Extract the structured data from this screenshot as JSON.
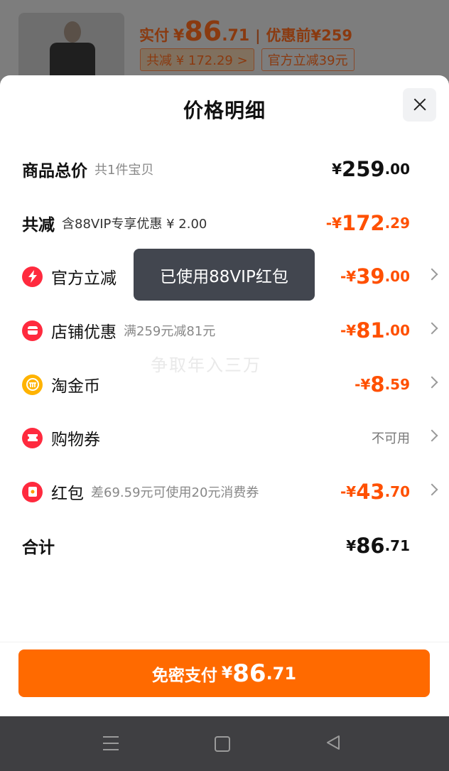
{
  "background": {
    "paid_label": "实付",
    "paid_symbol": "¥",
    "paid_int": "86",
    "paid_dec": ".71",
    "separator": "|",
    "before_label": "优惠前",
    "before_value": "¥259",
    "tag_discount": "共减 ¥ 172.29 >",
    "tag_official": "官方立减39元"
  },
  "sheet": {
    "title": "价格明细",
    "rows": [
      {
        "name": "商品总价",
        "sub": "共1件宝贝",
        "amount_prefix": "¥",
        "amount_int": "259",
        "amount_dec": ".00"
      },
      {
        "name": "共减",
        "sub": "含88VIP专享优惠 ¥ 2.00",
        "amount_prefix": "-¥",
        "amount_int": "172",
        "amount_dec": ".29"
      },
      {
        "name": "官方立减",
        "icon": "lightning-icon",
        "amount_prefix": "-¥",
        "amount_int": "39",
        "amount_dec": ".00"
      },
      {
        "name": "店铺优惠",
        "icon": "shop-icon",
        "sub": "满259元减81元",
        "amount_prefix": "-¥",
        "amount_int": "81",
        "amount_dec": ".00"
      },
      {
        "name": "淘金币",
        "icon": "gold-coin-icon",
        "amount_prefix": "-¥",
        "amount_int": "8",
        "amount_dec": ".59"
      },
      {
        "name": "购物券",
        "icon": "coupon-icon",
        "status": "不可用"
      },
      {
        "name": "红包",
        "icon": "red-packet-icon",
        "sub": "差69.59元可使用20元消费券",
        "amount_prefix": "-¥",
        "amount_int": "43",
        "amount_dec": ".70"
      },
      {
        "name": "合计",
        "amount_prefix": "¥",
        "amount_int": "86",
        "amount_dec": ".71"
      }
    ],
    "tooltip": "已使用88VIP红包",
    "watermark": "争取年入三万"
  },
  "pay_button": {
    "label": "免密支付",
    "symbol": "¥",
    "int": "86",
    "dec": ".71"
  },
  "colors": {
    "accent": "#ff5000",
    "button": "#ff6a00",
    "tooltip_bg": "#42464f"
  }
}
